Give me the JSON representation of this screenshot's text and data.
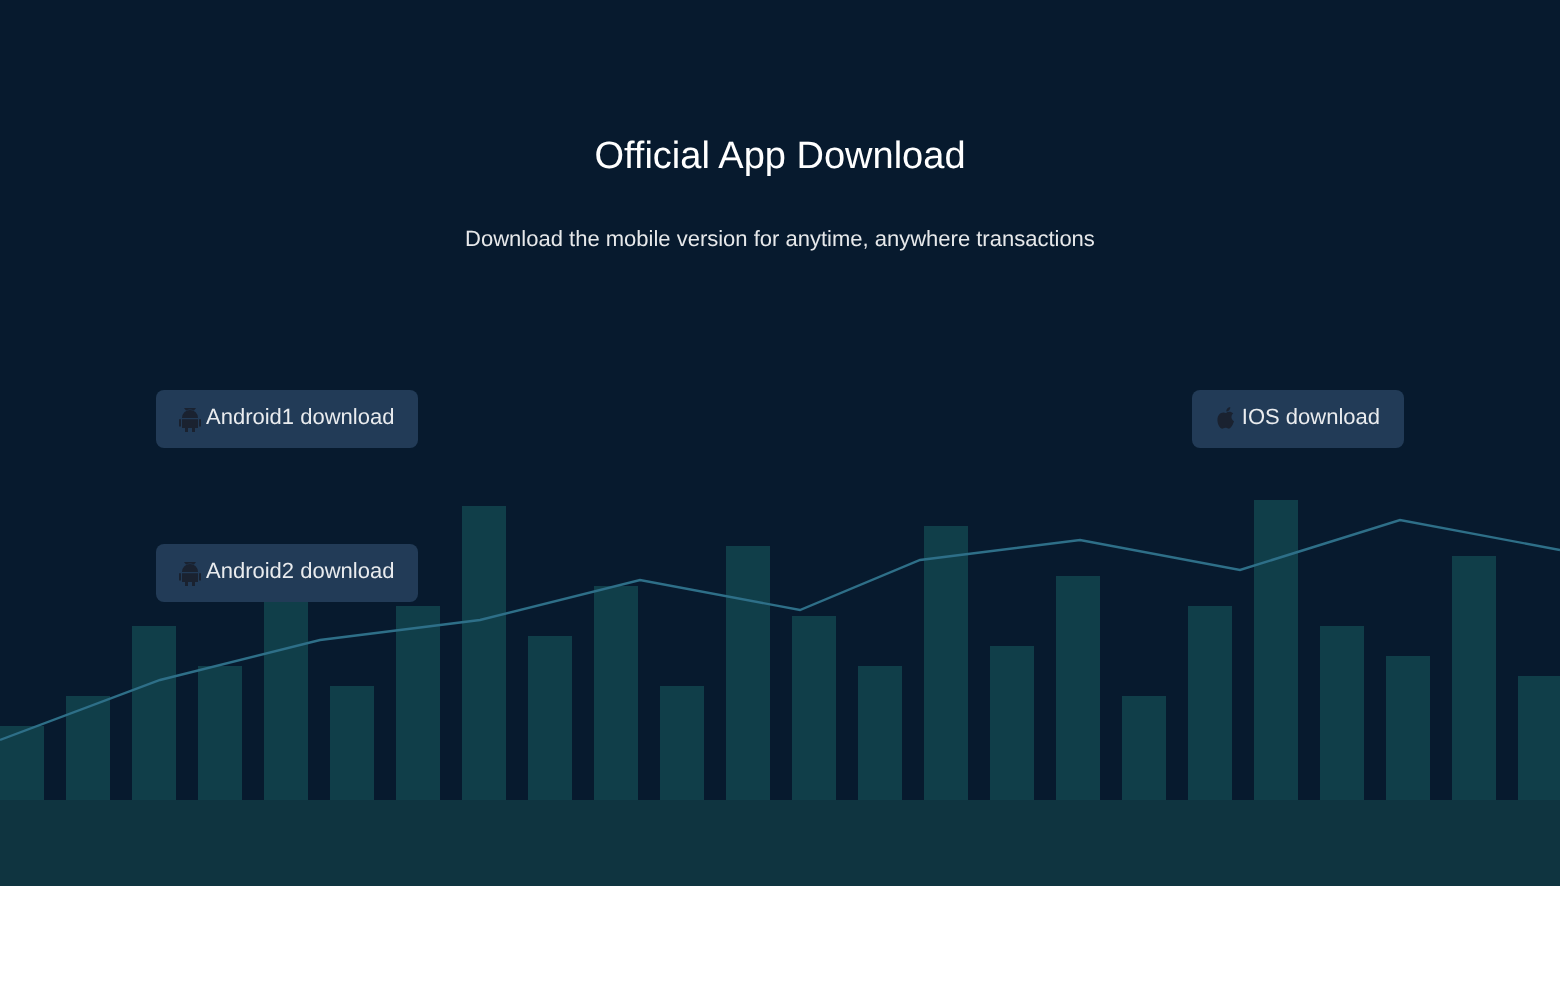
{
  "title": "Official App Download",
  "subtitle": "Download the mobile version for anytime, anywhere transactions",
  "left_buttons": [
    {
      "kind": "android",
      "label": "Android1 download"
    },
    {
      "kind": "android",
      "label": "Android2 download"
    }
  ],
  "right_buttons": [
    {
      "kind": "ios",
      "label": "IOS download"
    }
  ]
}
